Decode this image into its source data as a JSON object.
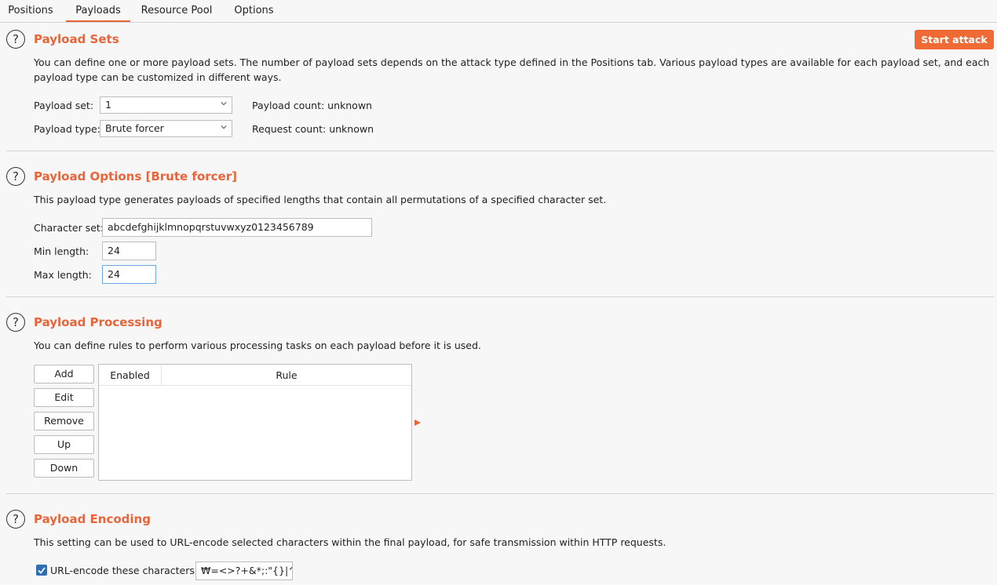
{
  "tabs": [
    {
      "label": "Positions"
    },
    {
      "label": "Payloads"
    },
    {
      "label": "Resource Pool"
    },
    {
      "label": "Options"
    }
  ],
  "start_attack_label": "Start attack",
  "payload_sets": {
    "title": "Payload Sets",
    "description_line1": "You can define one or more payload sets. The number of payload sets depends on the attack type defined in the Positions tab. Various payload types are available for each payload set, and each",
    "description_line2": "payload type can be customized in different ways.",
    "set_label": "Payload set:",
    "set_value": "1",
    "type_label": "Payload type:",
    "type_value": "Brute forcer",
    "payload_count": "Payload count:  unknown",
    "request_count": "Request count:  unknown"
  },
  "payload_options": {
    "title": "Payload Options [Brute forcer]",
    "description": "This payload type generates payloads of specified lengths that contain all permutations of a specified character set.",
    "charset_label": "Character set:",
    "charset_value": "abcdefghijklmnopqrstuvwxyz0123456789",
    "min_label": "Min length:",
    "min_value": "24",
    "max_label": "Max length:",
    "max_value": "24"
  },
  "payload_processing": {
    "title": "Payload Processing",
    "description": "You can define rules to perform various processing tasks on each payload before it is used.",
    "buttons": {
      "add": "Add",
      "edit": "Edit",
      "remove": "Remove",
      "up": "Up",
      "down": "Down"
    },
    "columns": {
      "enabled": "Enabled",
      "rule": "Rule"
    }
  },
  "payload_encoding": {
    "title": "Payload Encoding",
    "description": "This setting can be used to URL-encode selected characters within the final payload, for safe transmission within HTTP requests.",
    "checkbox_label": "URL-encode these characters:",
    "checkbox_checked": true,
    "chars_value": "₩=<>?+&*;:\"{}|^`#"
  },
  "colors": {
    "accent": "#e8653a",
    "button": "#f06a36",
    "checkbox": "#2f6fb5",
    "focus": "#6aa7e6"
  }
}
